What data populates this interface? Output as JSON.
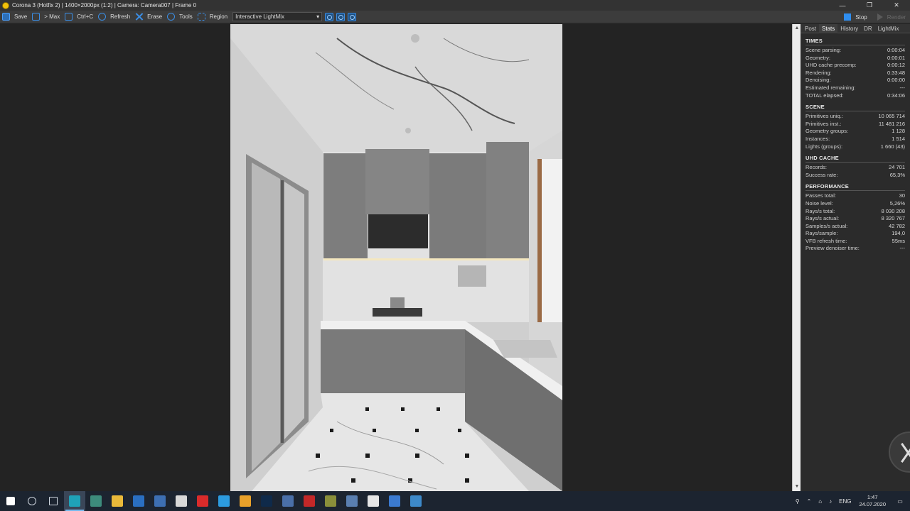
{
  "window": {
    "title": "Corona 3 (Hotfix 2) | 1400×2000px (1:2) | Camera: Camera007 | Frame 0",
    "controls": [
      "—",
      "❐",
      "✕"
    ]
  },
  "toolbar": {
    "save": "Save",
    "max": "> Max",
    "copy": "Ctrl+C",
    "refresh": "Refresh",
    "erase": "Erase",
    "tools": "Tools",
    "region": "Region",
    "lightmix_mode": "Interactive LightMix",
    "stop": "Stop",
    "render": "Render"
  },
  "panel": {
    "tabs": [
      "Post",
      "Stats",
      "History",
      "DR",
      "LightMix"
    ],
    "active_tab": "Stats",
    "sections": {
      "times": {
        "title": "TIMES",
        "rows": [
          {
            "label": "Scene parsing:",
            "value": "0:00:04"
          },
          {
            "label": "Geometry:",
            "value": "0:00:01"
          },
          {
            "label": "UHD cache precomp:",
            "value": "0:00:12"
          },
          {
            "label": "Rendering:",
            "value": "0:33:48"
          },
          {
            "label": "Denoising:",
            "value": "0:00:00"
          },
          {
            "label": "Estimated remaining:",
            "value": "---"
          },
          {
            "label": "TOTAL elapsed:",
            "value": "0:34:06"
          }
        ]
      },
      "scene": {
        "title": "SCENE",
        "rows": [
          {
            "label": "Primitives uniq.:",
            "value": "10 065 714"
          },
          {
            "label": "Primitives inst.:",
            "value": "11 481 216"
          },
          {
            "label": "Geometry groups:",
            "value": "1 128"
          },
          {
            "label": "Instances:",
            "value": "1 514"
          },
          {
            "label": "Lights (groups):",
            "value": "1 660 (43)"
          }
        ]
      },
      "uhd": {
        "title": "UHD CACHE",
        "rows": [
          {
            "label": "Records:",
            "value": "24 701"
          },
          {
            "label": "Success rate:",
            "value": "65,3%"
          }
        ]
      },
      "performance": {
        "title": "PERFORMANCE",
        "rows": [
          {
            "label": "Passes total:",
            "value": "30"
          },
          {
            "label": "Noise level:",
            "value": "5,26%"
          },
          {
            "label": "Rays/s total:",
            "value": "8 030 208"
          },
          {
            "label": "Rays/s actual:",
            "value": "8 320 767"
          },
          {
            "label": "Samples/s actual:",
            "value": "42 782"
          },
          {
            "label": "Rays/sample:",
            "value": "194,0"
          },
          {
            "label": "VFB refresh time:",
            "value": "55ms"
          },
          {
            "label": "Preview denoiser time:",
            "value": "---"
          }
        ]
      }
    }
  },
  "taskbar": {
    "apps": [
      "start",
      "search",
      "task-view",
      "corona-vfb",
      "autocad",
      "explorer",
      "outlook",
      "remote-desktop",
      "calculator",
      "opera",
      "telegram",
      "yandex",
      "photoshop",
      "sketchup",
      "recorder",
      "chrome-alt",
      "mail",
      "photos",
      "vmware",
      "network-globe"
    ],
    "active_app": "corona-vfb",
    "tray": {
      "lang": "ENG",
      "time": "1:47",
      "date": "24.07.2020"
    }
  },
  "colors": {
    "accent": "#3a8ee6",
    "panel_bg": "#2b2b2b",
    "viewport_bg": "#232323",
    "taskbar_bg": "#1c2430"
  }
}
